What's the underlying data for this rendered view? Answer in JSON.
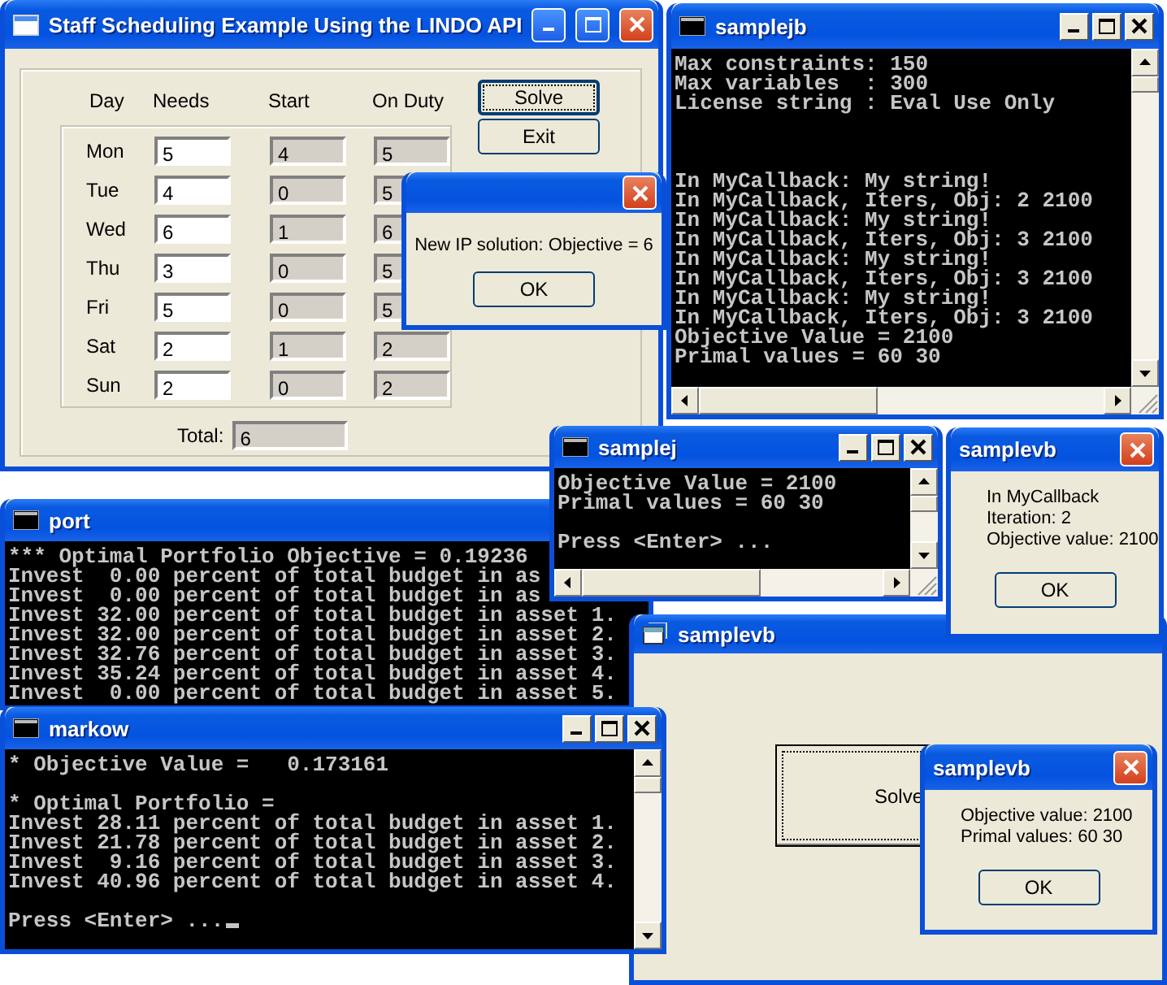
{
  "staff_window": {
    "title": "Staff Scheduling Example Using the LINDO API",
    "columns": [
      "Day",
      "Needs",
      "Start",
      "On Duty"
    ],
    "rows": [
      {
        "day": "Mon",
        "needs": "5",
        "start": "4",
        "on_duty": "5"
      },
      {
        "day": "Tue",
        "needs": "4",
        "start": "0",
        "on_duty": "5"
      },
      {
        "day": "Wed",
        "needs": "6",
        "start": "1",
        "on_duty": "6"
      },
      {
        "day": "Thu",
        "needs": "3",
        "start": "0",
        "on_duty": "5"
      },
      {
        "day": "Fri",
        "needs": "5",
        "start": "0",
        "on_duty": "5"
      },
      {
        "day": "Sat",
        "needs": "2",
        "start": "1",
        "on_duty": "2"
      },
      {
        "day": "Sun",
        "needs": "2",
        "start": "0",
        "on_duty": "2"
      }
    ],
    "total_label": "Total:",
    "total": "6",
    "buttons": [
      "Solve",
      "Exit"
    ]
  },
  "port_window": {
    "title": "port",
    "blocks": [
      [
        "*** Optimal Portfolio Objective = 0.19236",
        "Invest  0.00 percent of total budget in as",
        "Invest  0.00 percent of total budget in as",
        "Invest 32.00 percent of total budget in asset 1.",
        "Invest 32.00 percent of total budget in asset 2.",
        "Invest 32.76 percent of total budget in asset 3.",
        "Invest 35.24 percent of total budget in asset 4.",
        "Invest  0.00 percent of total budget in asset 5."
      ]
    ]
  },
  "markow_window": {
    "title": "markow",
    "blocks": [
      [
        "* Objective Value =   0.173161"
      ],
      [
        "* Optimal Portfolio =",
        "Invest 28.11 percent of total budget in asset 1.",
        "Invest 21.78 percent of total budget in asset 2.",
        "Invest  9.16 percent of total budget in asset 3.",
        "Invest 40.96 percent of total budget in asset 4."
      ],
      [
        "Press <Enter> ..."
      ]
    ],
    "cursor": true
  },
  "samplevb_window": {
    "title": "samplevb",
    "button": "Solve"
  },
  "samplejb_window": {
    "title": "samplejb",
    "blocks": [
      [
        "Max constraints: 150",
        "Max variables  : 300",
        "License string : Eval Use Only"
      ],
      [
        "In MyCallback: My string!",
        "In MyCallback, Iters, Obj: 2 2100",
        "In MyCallback: My string!",
        "In MyCallback, Iters, Obj: 3 2100",
        "In MyCallback: My string!",
        "In MyCallback, Iters, Obj: 3 2100",
        "In MyCallback: My string!",
        "In MyCallback, Iters, Obj: 3 2100",
        "Objective Value = 2100",
        "Primal values = 60 30"
      ]
    ]
  },
  "samplej_window": {
    "title": "samplej",
    "blocks": [
      [
        "Objective Value = 2100",
        "Primal values = 60 30"
      ],
      [
        "Press <Enter> ..."
      ]
    ]
  },
  "callback_dialog": {
    "title": "samplevb",
    "lines": [
      "In MyCallback",
      "Iteration: 2",
      "Objective value:  2100"
    ],
    "button": "OK"
  },
  "result_dialog": {
    "title": "samplevb",
    "lines": [
      "Objective value: 2100",
      "Primal values: 60 30"
    ],
    "button": "OK"
  },
  "ip_dialog": {
    "message": "New IP solution: Objective = 6",
    "button": "OK"
  }
}
